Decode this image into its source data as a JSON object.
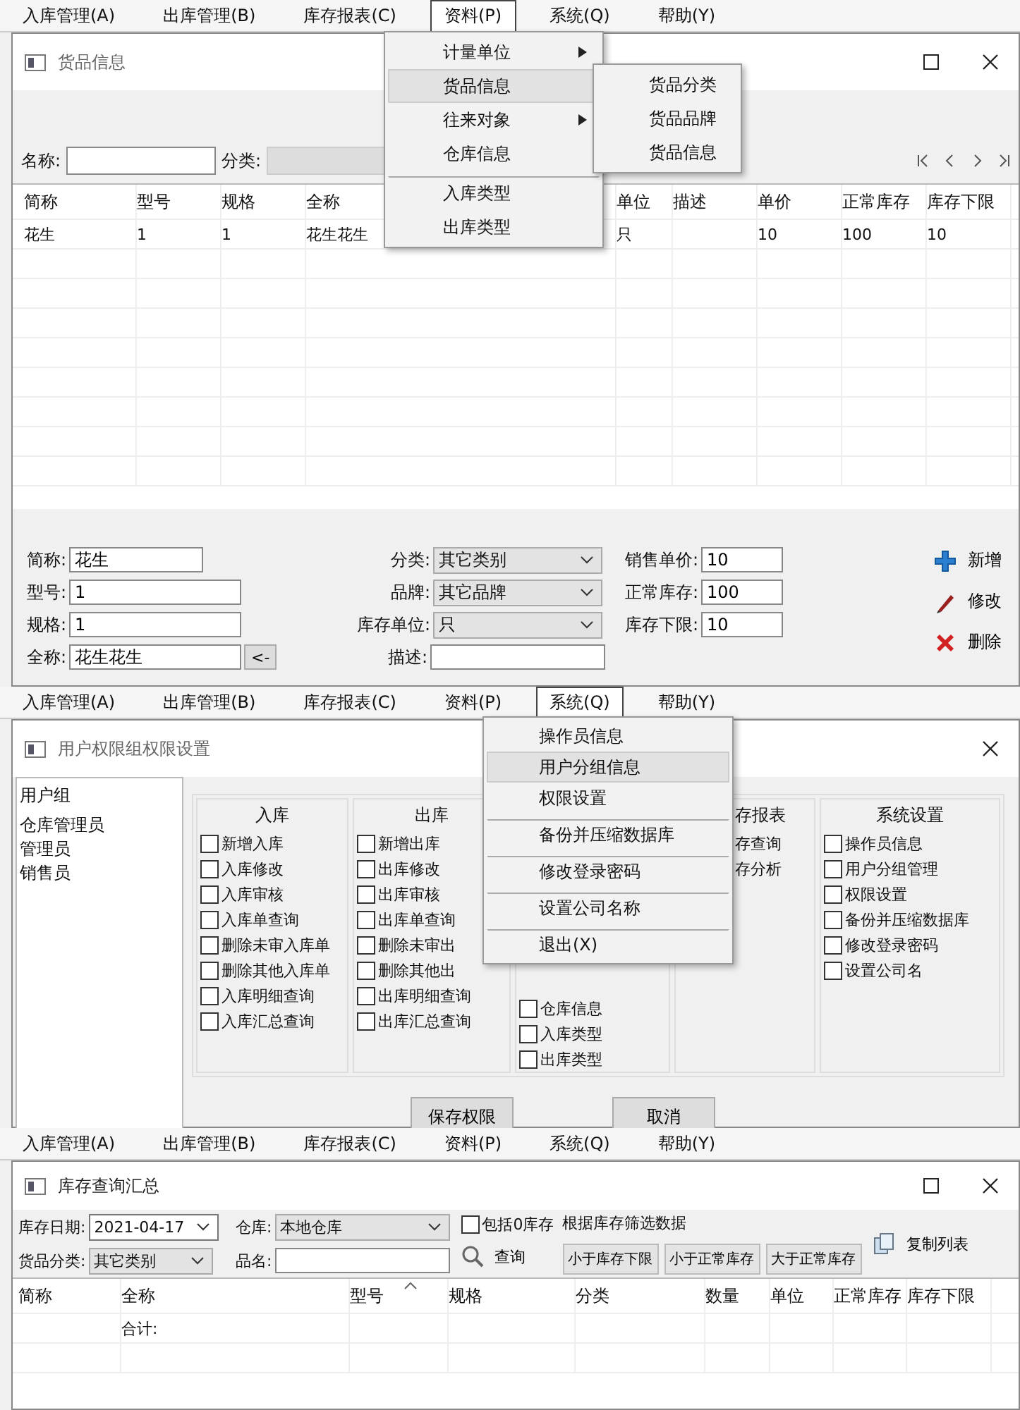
{
  "goods_screen": {
    "menu_bar": [
      {
        "label": "入库管理(A)",
        "selected": false
      },
      {
        "label": "出库管理(B)",
        "selected": false
      },
      {
        "label": "库存报表(C)",
        "selected": false
      },
      {
        "label": "资料(P)",
        "selected": true
      },
      {
        "label": "系统(Q)",
        "selected": false
      },
      {
        "label": "帮助(Y)",
        "selected": false
      }
    ],
    "open_menu": [
      {
        "label": "计量单位",
        "submenu": true,
        "selected": false,
        "separator_before": false
      },
      {
        "label": "货品信息",
        "submenu": false,
        "selected": true,
        "separator_before": false
      },
      {
        "label": "往来对象",
        "submenu": true,
        "selected": false,
        "separator_before": false
      },
      {
        "label": "仓库信息",
        "submenu": false,
        "selected": false,
        "separator_before": false
      },
      {
        "label": "入库类型",
        "submenu": false,
        "selected": false,
        "separator_before": true
      },
      {
        "label": "出库类型",
        "submenu": false,
        "selected": false,
        "separator_before": false
      }
    ],
    "submenu": [
      {
        "label": "货品分类",
        "selected": false
      },
      {
        "label": "货品品牌",
        "selected": false
      },
      {
        "label": "货品信息",
        "selected": false
      }
    ],
    "window": {
      "title": "货品信息"
    },
    "filter": {
      "name_label": "名称:",
      "category_label": "分类:"
    },
    "table": {
      "columns": [
        "简称",
        "型号",
        "规格",
        "全称",
        "单位",
        "描述",
        "单价",
        "正常库存",
        "库存下限"
      ],
      "rows": [
        [
          "花生",
          "1",
          "1",
          "花生花生",
          "只",
          null,
          "10",
          "100",
          "10"
        ]
      ]
    },
    "form": {
      "left": [
        {
          "label": "简称:",
          "value": "花生"
        },
        {
          "label": "型号:",
          "value": "1"
        },
        {
          "label": "规格:",
          "value": "1"
        },
        {
          "label": "全称:",
          "value": "花生花生",
          "button": "<-"
        }
      ],
      "middle": [
        {
          "label": "分类:",
          "value": "其它类别",
          "kind": "select"
        },
        {
          "label": "品牌:",
          "value": "其它品牌",
          "kind": "select"
        },
        {
          "label": "库存单位:",
          "value": "只",
          "kind": "select"
        },
        {
          "label": "描述:",
          "kind": "input"
        }
      ],
      "right": [
        {
          "label": "销售单价:",
          "value": "10"
        },
        {
          "label": "正常库存:",
          "value": "100"
        },
        {
          "label": "库存下限:",
          "value": "10"
        }
      ]
    },
    "actions": [
      {
        "label": "新增",
        "kind": "add"
      },
      {
        "label": "修改",
        "kind": "edit"
      },
      {
        "label": "删除",
        "kind": "delete"
      }
    ]
  },
  "permission_screen": {
    "menu_bar": [
      {
        "label": "入库管理(A)",
        "selected": false
      },
      {
        "label": "出库管理(B)",
        "selected": false
      },
      {
        "label": "库存报表(C)",
        "selected": false
      },
      {
        "label": "资料(P)",
        "selected": false
      },
      {
        "label": "系统(Q)",
        "selected": true
      },
      {
        "label": "帮助(Y)",
        "selected": false
      }
    ],
    "open_menu": [
      {
        "label": "操作员信息",
        "selected": false,
        "separator_before": false
      },
      {
        "label": "用户分组信息",
        "selected": true,
        "separator_before": false
      },
      {
        "label": "权限设置",
        "selected": false,
        "separator_before": false
      },
      {
        "label": "备份并压缩数据库",
        "selected": false,
        "separator_before": true
      },
      {
        "label": "修改登录密码",
        "selected": false,
        "separator_before": true
      },
      {
        "label": "设置公司名称",
        "selected": false,
        "separator_before": true
      },
      {
        "label": "退出(X)",
        "selected": false,
        "separator_before": true
      }
    ],
    "window": {
      "title": "用户权限组权限设置"
    },
    "user_groups": {
      "header": "用户组",
      "items": [
        {
          "label": "仓库管理员",
          "selected": false
        },
        {
          "label": "管理员",
          "selected": false
        },
        {
          "label": "销售员",
          "selected": false
        }
      ]
    },
    "groups": [
      {
        "title": "入库",
        "items": [
          {
            "label": "新增入库",
            "checked": false
          },
          {
            "label": "入库修改",
            "checked": false
          },
          {
            "label": "入库审核",
            "checked": false
          },
          {
            "label": "入库单查询",
            "checked": false
          },
          {
            "label": "删除未审入库单",
            "checked": false
          },
          {
            "label": "删除其他入库单",
            "checked": false
          },
          {
            "label": "入库明细查询",
            "checked": false
          },
          {
            "label": "入库汇总查询",
            "checked": false
          }
        ]
      },
      {
        "title": "出库",
        "items": [
          {
            "label": "新增出库",
            "checked": false
          },
          {
            "label": "出库修改",
            "checked": false
          },
          {
            "label": "出库审核",
            "checked": false
          },
          {
            "label": "出库单查询",
            "checked": false
          },
          {
            "label": "删除未审出",
            "checked": false
          },
          {
            "label": "删除其他出",
            "checked": false
          },
          {
            "label": "出库明细查询",
            "checked": false
          },
          {
            "label": "出库汇总查询",
            "checked": false
          }
        ]
      },
      {
        "items": [
          {
            "label": "仓库信息",
            "checked": false
          },
          {
            "label": "入库类型",
            "checked": false
          },
          {
            "label": "出库类型",
            "checked": false
          }
        ]
      },
      {
        "title": "存报表",
        "items": [
          {
            "label": "存查询"
          },
          {
            "label": "存分析"
          }
        ]
      },
      {
        "title": "系统设置",
        "items": [
          {
            "label": "操作员信息",
            "checked": false
          },
          {
            "label": "用户分组管理",
            "checked": false
          },
          {
            "label": "权限设置",
            "checked": false
          },
          {
            "label": "备份并压缩数据库",
            "checked": false
          },
          {
            "label": "修改登录密码",
            "checked": false
          },
          {
            "label": "设置公司名",
            "checked": false
          }
        ]
      }
    ],
    "buttons": [
      "保存权限",
      "取消"
    ]
  },
  "stock_screen": {
    "menu_bar": [
      {
        "label": "入库管理(A)",
        "selected": false
      },
      {
        "label": "出库管理(B)",
        "selected": false
      },
      {
        "label": "库存报表(C)",
        "selected": false
      },
      {
        "label": "资料(P)",
        "selected": false
      },
      {
        "label": "系统(Q)",
        "selected": false
      },
      {
        "label": "帮助(Y)",
        "selected": false
      }
    ],
    "window": {
      "title": "库存查询汇总"
    },
    "date": {
      "label": "库存日期:",
      "value": "2021-04-17"
    },
    "category": {
      "label": "货品分类:",
      "value": "其它类别"
    },
    "warehouse": {
      "label": "仓库:",
      "value": "本地仓库"
    },
    "product_name": {
      "label": "品名:"
    },
    "include_zero": {
      "label": "包括0库存",
      "checked": false
    },
    "query_button": "查询",
    "filter_title": "根据库存筛选数据",
    "filter_buttons": [
      "小于库存下限",
      "小于正常库存",
      "大于正常库存"
    ],
    "copy_button": "复制列表",
    "table": {
      "columns": [
        {
          "label": "简称",
          "sorted": false
        },
        {
          "label": "全称",
          "sorted": false
        },
        {
          "label": "型号",
          "sorted": true
        },
        {
          "label": "规格",
          "sorted": false
        },
        {
          "label": "分类",
          "sorted": false
        },
        {
          "label": "数量",
          "sorted": false
        },
        {
          "label": "单位",
          "sorted": false
        },
        {
          "label": "正常库存",
          "sorted": false
        },
        {
          "label": "库存下限",
          "sorted": false
        }
      ],
      "total_label": "合计:"
    }
  }
}
